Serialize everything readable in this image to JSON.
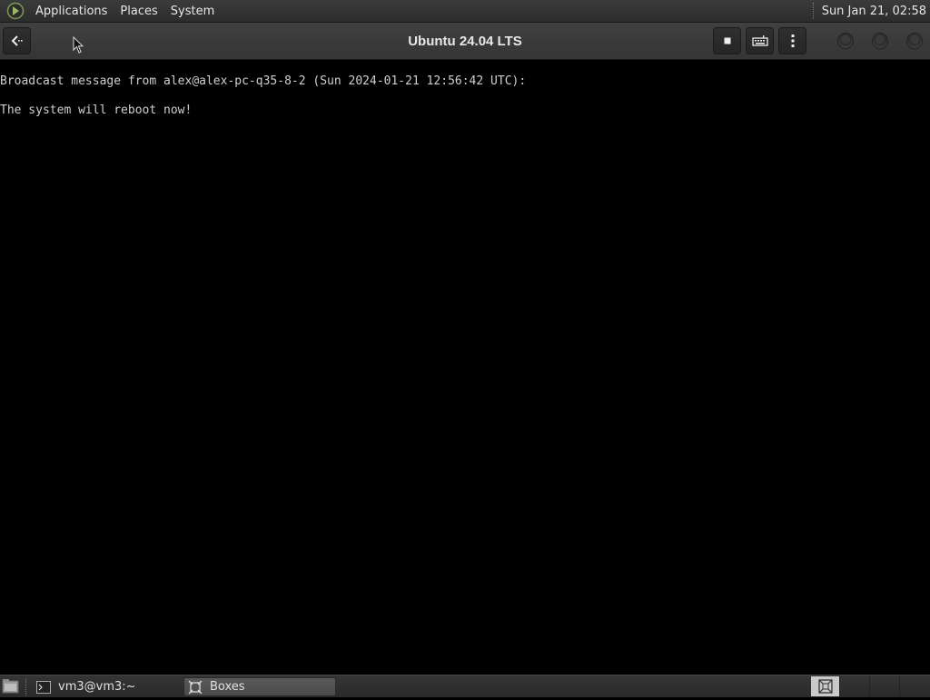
{
  "top_panel": {
    "menus": [
      "Applications",
      "Places",
      "System"
    ],
    "clock": "Sun Jan 21, 02:58"
  },
  "headerbar": {
    "title": "Ubuntu 24.04 LTS",
    "back_icon": "back-arrow-icon",
    "buttons": [
      "stop-icon",
      "keyboard-icon",
      "kebab-menu-icon"
    ]
  },
  "terminal": {
    "lines": [
      "Broadcast message from alex@alex-pc-q35-8-2 (Sun 2024-01-21 12:56:42 UTC):",
      "The system will reboot now!"
    ]
  },
  "taskbar": {
    "tasks": [
      {
        "label": "vm3@vm3:~",
        "icon": "terminal-icon",
        "active": false
      },
      {
        "label": "Boxes",
        "icon": "boxes-icon",
        "active": true
      }
    ]
  },
  "colors": {
    "panel": "#2c2c2c",
    "terminal_bg": "#000000",
    "terminal_fg": "#cfcfcf"
  }
}
